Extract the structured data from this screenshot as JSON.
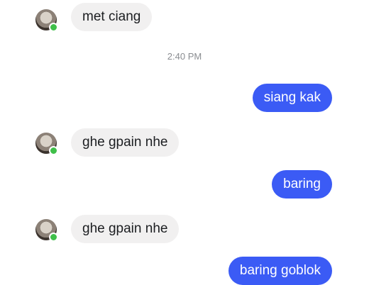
{
  "messages": [
    {
      "sender": "contact",
      "text": "met ciang"
    },
    {
      "sender": "me",
      "text": "siang kak"
    },
    {
      "sender": "contact",
      "text": "ghe gpain nhe"
    },
    {
      "sender": "me",
      "text": "baring"
    },
    {
      "sender": "contact",
      "text": "ghe gpain nhe"
    },
    {
      "sender": "me",
      "text": "baring goblok"
    }
  ],
  "timestamp": "2:40 PM",
  "colors": {
    "outgoing_bubble": "#3b5bf5",
    "incoming_bubble": "#f1f0f0",
    "online_indicator": "#3fbf49"
  }
}
